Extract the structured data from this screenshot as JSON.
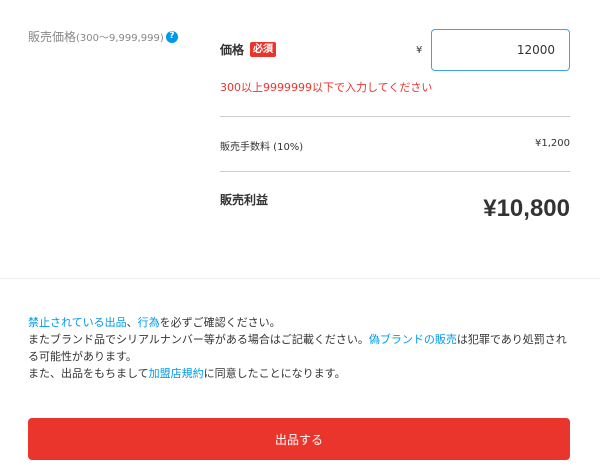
{
  "price_section": {
    "left_label": "販売価格",
    "left_label_range": "(300〜9,999,999)",
    "help_icon_glyph": "?",
    "price_label": "価格",
    "required_badge": "必須",
    "currency_symbol": "¥",
    "price_value": "12000",
    "error_message": "300以上9999999以下で入力してください",
    "fee_label": "販売手数料 (10%)",
    "fee_value": "¥1,200",
    "profit_label": "販売利益",
    "profit_value": "¥10,800"
  },
  "notice": {
    "line1_link1": "禁止されている出品",
    "line1_sep": "、",
    "line1_link2": "行為",
    "line1_text": "を必ずご確認ください。",
    "line2_text": "またブランド品でシリアルナンバー等がある場合はご記載ください。",
    "line2_link": "偽ブランドの販売",
    "line2_text2": "は犯罪であり処罰される可能性があります。",
    "line3_text": "また、出品をもちまして",
    "line3_link": "加盟店規約",
    "line3_text2": "に同意したことになります。"
  },
  "submit_button_label": "出品する",
  "colors": {
    "accent_red": "#ea352d",
    "link_blue": "#0099e8",
    "input_border": "#3ca4e0"
  },
  "icons": {
    "help": "question-circle-icon"
  }
}
